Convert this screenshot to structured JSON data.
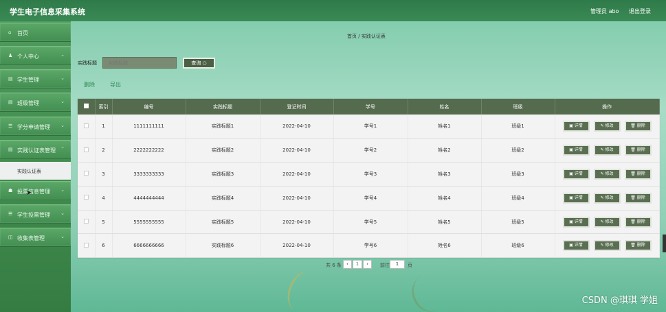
{
  "app": {
    "title": "学生电子信息采集系统"
  },
  "top_right": {
    "user": "管理员 abo",
    "logout": "退出登录"
  },
  "sidebar": {
    "items": [
      {
        "icon": "home-icon",
        "label": "首页",
        "glyph": "⌂"
      },
      {
        "icon": "user-icon",
        "label": "个人中心",
        "glyph": "♟"
      },
      {
        "icon": "list-icon",
        "label": "学生管理",
        "glyph": "▤"
      },
      {
        "icon": "list-icon",
        "label": "班级管理",
        "glyph": "▤"
      },
      {
        "icon": "list-icon",
        "label": "学分申请管理",
        "glyph": "☰"
      },
      {
        "icon": "list-icon",
        "label": "实践认证表管理",
        "glyph": "▤"
      },
      {
        "icon": "list-icon",
        "label": "投票信息管理",
        "glyph": "☗"
      },
      {
        "icon": "list-icon",
        "label": "学生投票管理",
        "glyph": "☰"
      },
      {
        "icon": "list-icon",
        "label": "收集表管理",
        "glyph": "◫"
      }
    ],
    "submenu": {
      "label": "实践认证表"
    }
  },
  "breadcrumb": {
    "home": "首页",
    "sep": "/",
    "current": "实践认证表"
  },
  "search": {
    "label": "实践标题",
    "placeholder": "实践标题",
    "button": "查询 ○"
  },
  "actions": {
    "delete": "删除",
    "export": "导出"
  },
  "table": {
    "columns": [
      "索引",
      "编号",
      "实践标题",
      "登记时间",
      "学号",
      "姓名",
      "班级",
      "操作"
    ],
    "rows": [
      {
        "index": "1",
        "code": "1111111111",
        "title": "实践标题1",
        "date": "2022-04-10",
        "sid": "学号1",
        "name": "姓名1",
        "cls": "班级1"
      },
      {
        "index": "2",
        "code": "2222222222",
        "title": "实践标题2",
        "date": "2022-04-10",
        "sid": "学号2",
        "name": "姓名2",
        "cls": "班级2"
      },
      {
        "index": "3",
        "code": "3333333333",
        "title": "实践标题3",
        "date": "2022-04-10",
        "sid": "学号3",
        "name": "姓名3",
        "cls": "班级3"
      },
      {
        "index": "4",
        "code": "4444444444",
        "title": "实践标题4",
        "date": "2022-04-10",
        "sid": "学号4",
        "name": "姓名4",
        "cls": "班级4"
      },
      {
        "index": "5",
        "code": "5555555555",
        "title": "实践标题5",
        "date": "2022-04-10",
        "sid": "学号5",
        "name": "姓名5",
        "cls": "班级5"
      },
      {
        "index": "6",
        "code": "6666666666",
        "title": "实践标题6",
        "date": "2022-04-10",
        "sid": "学号6",
        "name": "姓名6",
        "cls": "班级6"
      }
    ],
    "op_labels": {
      "detail": "▣ 详情",
      "edit": "✎ 修改",
      "delete": "🗑 删除"
    }
  },
  "pagination": {
    "total": "共 6 条",
    "prev": "‹",
    "page": "1",
    "next": "›",
    "goto": "前往",
    "goto_page": "1",
    "unit": "页"
  },
  "watermark": "CSDN @琪琪 学姐"
}
